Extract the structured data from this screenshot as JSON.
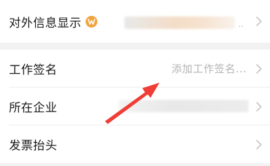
{
  "rows": {
    "external_info": {
      "label": "对外信息显示",
      "badge_icon": "v-badge-icon",
      "badge_color": "#f0a540",
      "ellipsis": ".."
    },
    "signature": {
      "label": "工作签名",
      "placeholder": "添加工作签名..."
    },
    "company": {
      "label": "所在企业"
    },
    "invoice": {
      "label": "发票抬头"
    }
  },
  "annotation": {
    "arrow_color": "#ef3e36"
  }
}
